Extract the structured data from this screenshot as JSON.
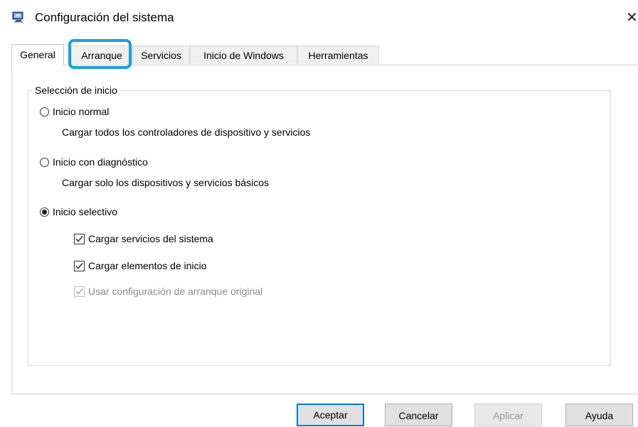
{
  "window": {
    "title": "Configuración del sistema",
    "icon": "system-config-icon",
    "close_icon": "close-icon"
  },
  "tabs": [
    {
      "label": "General",
      "active": true
    },
    {
      "label": "Arranque",
      "active": false,
      "highlighted": true
    },
    {
      "label": "Servicios",
      "active": false
    },
    {
      "label": "Inicio de Windows",
      "active": false
    },
    {
      "label": "Herramientas",
      "active": false
    }
  ],
  "highlight_color": "#1aa0e0",
  "startup_selection": {
    "group_label": "Selección de inicio",
    "normal": {
      "label": "Inicio normal",
      "description": "Cargar todos los controladores de dispositivo y servicios",
      "selected": false
    },
    "diagnostic": {
      "label": "Inicio con diagnóstico",
      "description": "Cargar solo los dispositivos y servicios básicos",
      "selected": false
    },
    "selective": {
      "label": "Inicio selectivo",
      "selected": true,
      "options": [
        {
          "label": "Cargar servicios del sistema",
          "checked": true,
          "enabled": true
        },
        {
          "label": "Cargar elementos de inicio",
          "checked": true,
          "enabled": true
        },
        {
          "label": "Usar configuración de arranque original",
          "checked": true,
          "enabled": false
        }
      ]
    }
  },
  "buttons": {
    "ok": "Aceptar",
    "cancel": "Cancelar",
    "apply": "Aplicar",
    "help": "Ayuda"
  },
  "accent_color": "#0078d7"
}
